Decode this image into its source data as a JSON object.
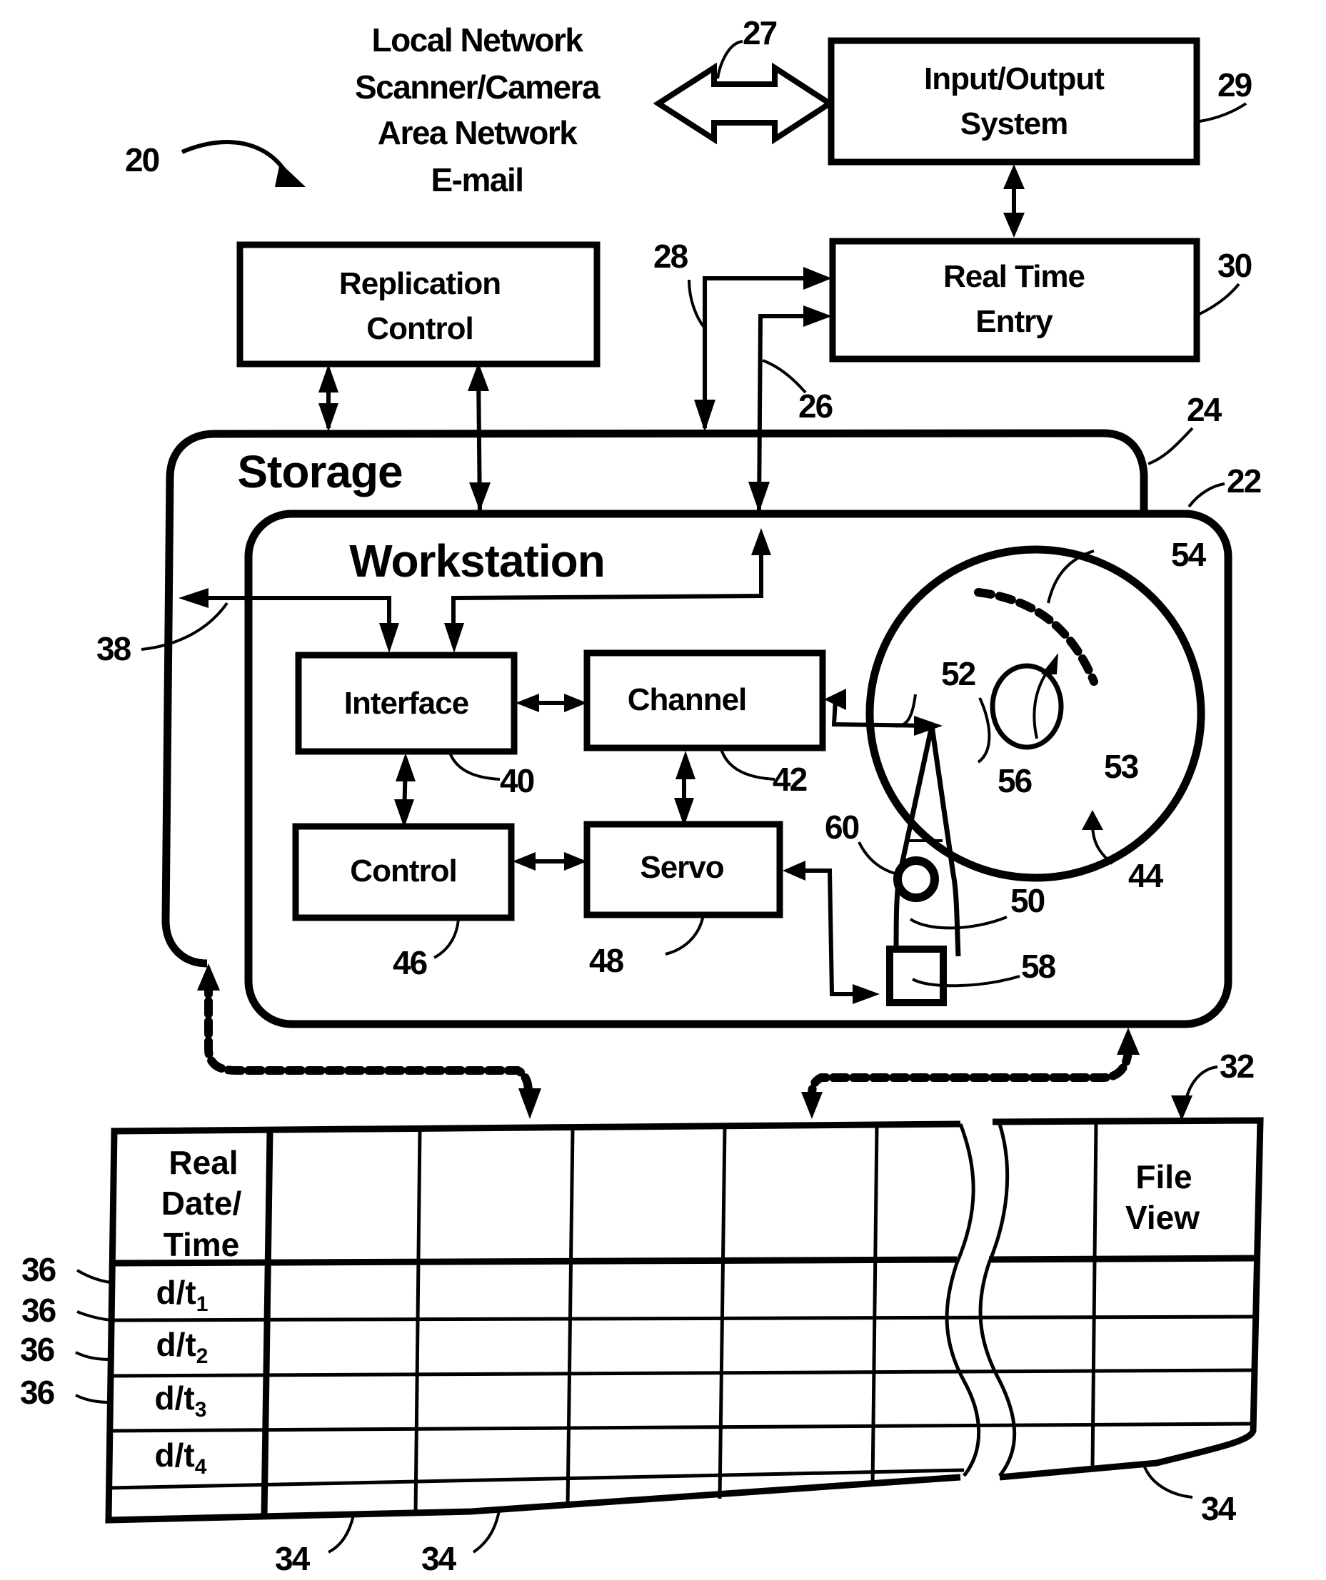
{
  "figure": {
    "ref_system": "20",
    "network_sources": {
      "lines": [
        "Local Network",
        "Scanner/Camera",
        "Area Network",
        "E-mail"
      ],
      "ref": "27"
    },
    "blocks": {
      "io_system": {
        "lines": [
          "Input/Output",
          "System"
        ],
        "ref": "29"
      },
      "real_time_entry": {
        "lines": [
          "Real Time",
          "Entry"
        ],
        "ref": "30"
      },
      "replication_control": {
        "lines": [
          "Replication",
          "Control"
        ]
      },
      "storage": {
        "label": "Storage",
        "ref": "24"
      },
      "workstation": {
        "label": "Workstation",
        "ref": "22"
      },
      "interface": {
        "label": "Interface",
        "ref": "40"
      },
      "channel": {
        "label": "Channel",
        "ref": "42"
      },
      "control": {
        "label": "Control",
        "ref": "46"
      },
      "servo": {
        "label": "Servo",
        "ref": "48"
      }
    },
    "connection_refs": {
      "line_28": "28",
      "line_26": "26",
      "line_38": "38"
    },
    "disk": {
      "disk_ref": "44",
      "head_ref": "52",
      "track_ref": "53",
      "sector_ref": "54",
      "spindle_ref": "56",
      "arm_ref": "50",
      "actuator_ref": "58",
      "pivot_ref": "60"
    },
    "table": {
      "ref": "32",
      "column_ref": "34",
      "row_ref": "36",
      "header_first": [
        "Real",
        "Date/",
        "Time"
      ],
      "header_last": [
        "File",
        "View"
      ],
      "rows": [
        {
          "base": "d/t",
          "sub": "1"
        },
        {
          "base": "d/t",
          "sub": "2"
        },
        {
          "base": "d/t",
          "sub": "3"
        },
        {
          "base": "d/t",
          "sub": "4"
        }
      ]
    }
  }
}
